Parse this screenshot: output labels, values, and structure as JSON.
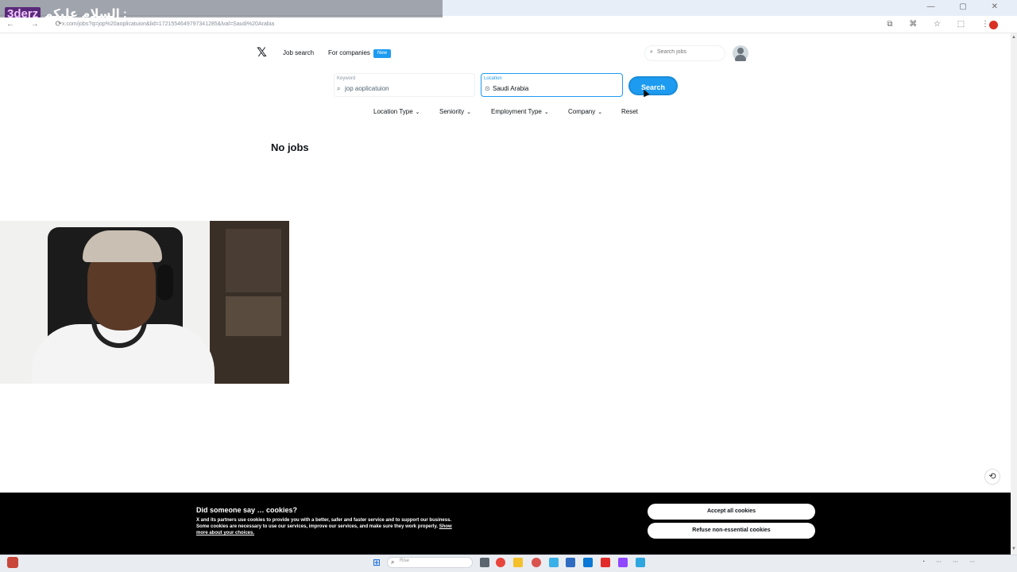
{
  "browser": {
    "overlay_tag": "3derz",
    "overlay_text": "السلام عليكم :",
    "url": "x.com/jobs?q=jop%20aoplicatuion&lid=1721554649797341285&lval=Saudi%20Arabia",
    "nav_icons": "← → ⟳",
    "toolbar_icons": "⧉ ⌘ ☆ ⬚ ⋮",
    "window_controls": "— ▢ ✕"
  },
  "header": {
    "logo": "𝕏",
    "nav_job_search": "Job search",
    "nav_for_companies": "For companies",
    "badge_new": "New",
    "search_placeholder": "Search jobs"
  },
  "search_form": {
    "keyword_label": "Keyword",
    "keyword_value": "jop aoplicatuion",
    "location_label": "Location",
    "location_value": "Saudi Arabia",
    "search_button": "Search"
  },
  "filters": {
    "location_type": "Location Type",
    "seniority": "Seniority",
    "employment_type": "Employment Type",
    "company": "Company",
    "reset": "Reset"
  },
  "results": {
    "title": "No jobs"
  },
  "cookie_banner": {
    "title": "Did someone say … cookies?",
    "text": "X and its partners use cookies to provide you with a better, safer and faster service and to support our business. Some cookies are necessary to use our services, improve our services, and make sure they work properly.",
    "link": "Show more about your choices.",
    "accept": "Accept all cookies",
    "refuse": "Refuse non-essential cookies"
  },
  "taskbar": {
    "search_placeholder": "Rise"
  },
  "colors": {
    "accent": "#1d9bf0",
    "banner_bg": "#000000",
    "text": "#0f1419"
  }
}
